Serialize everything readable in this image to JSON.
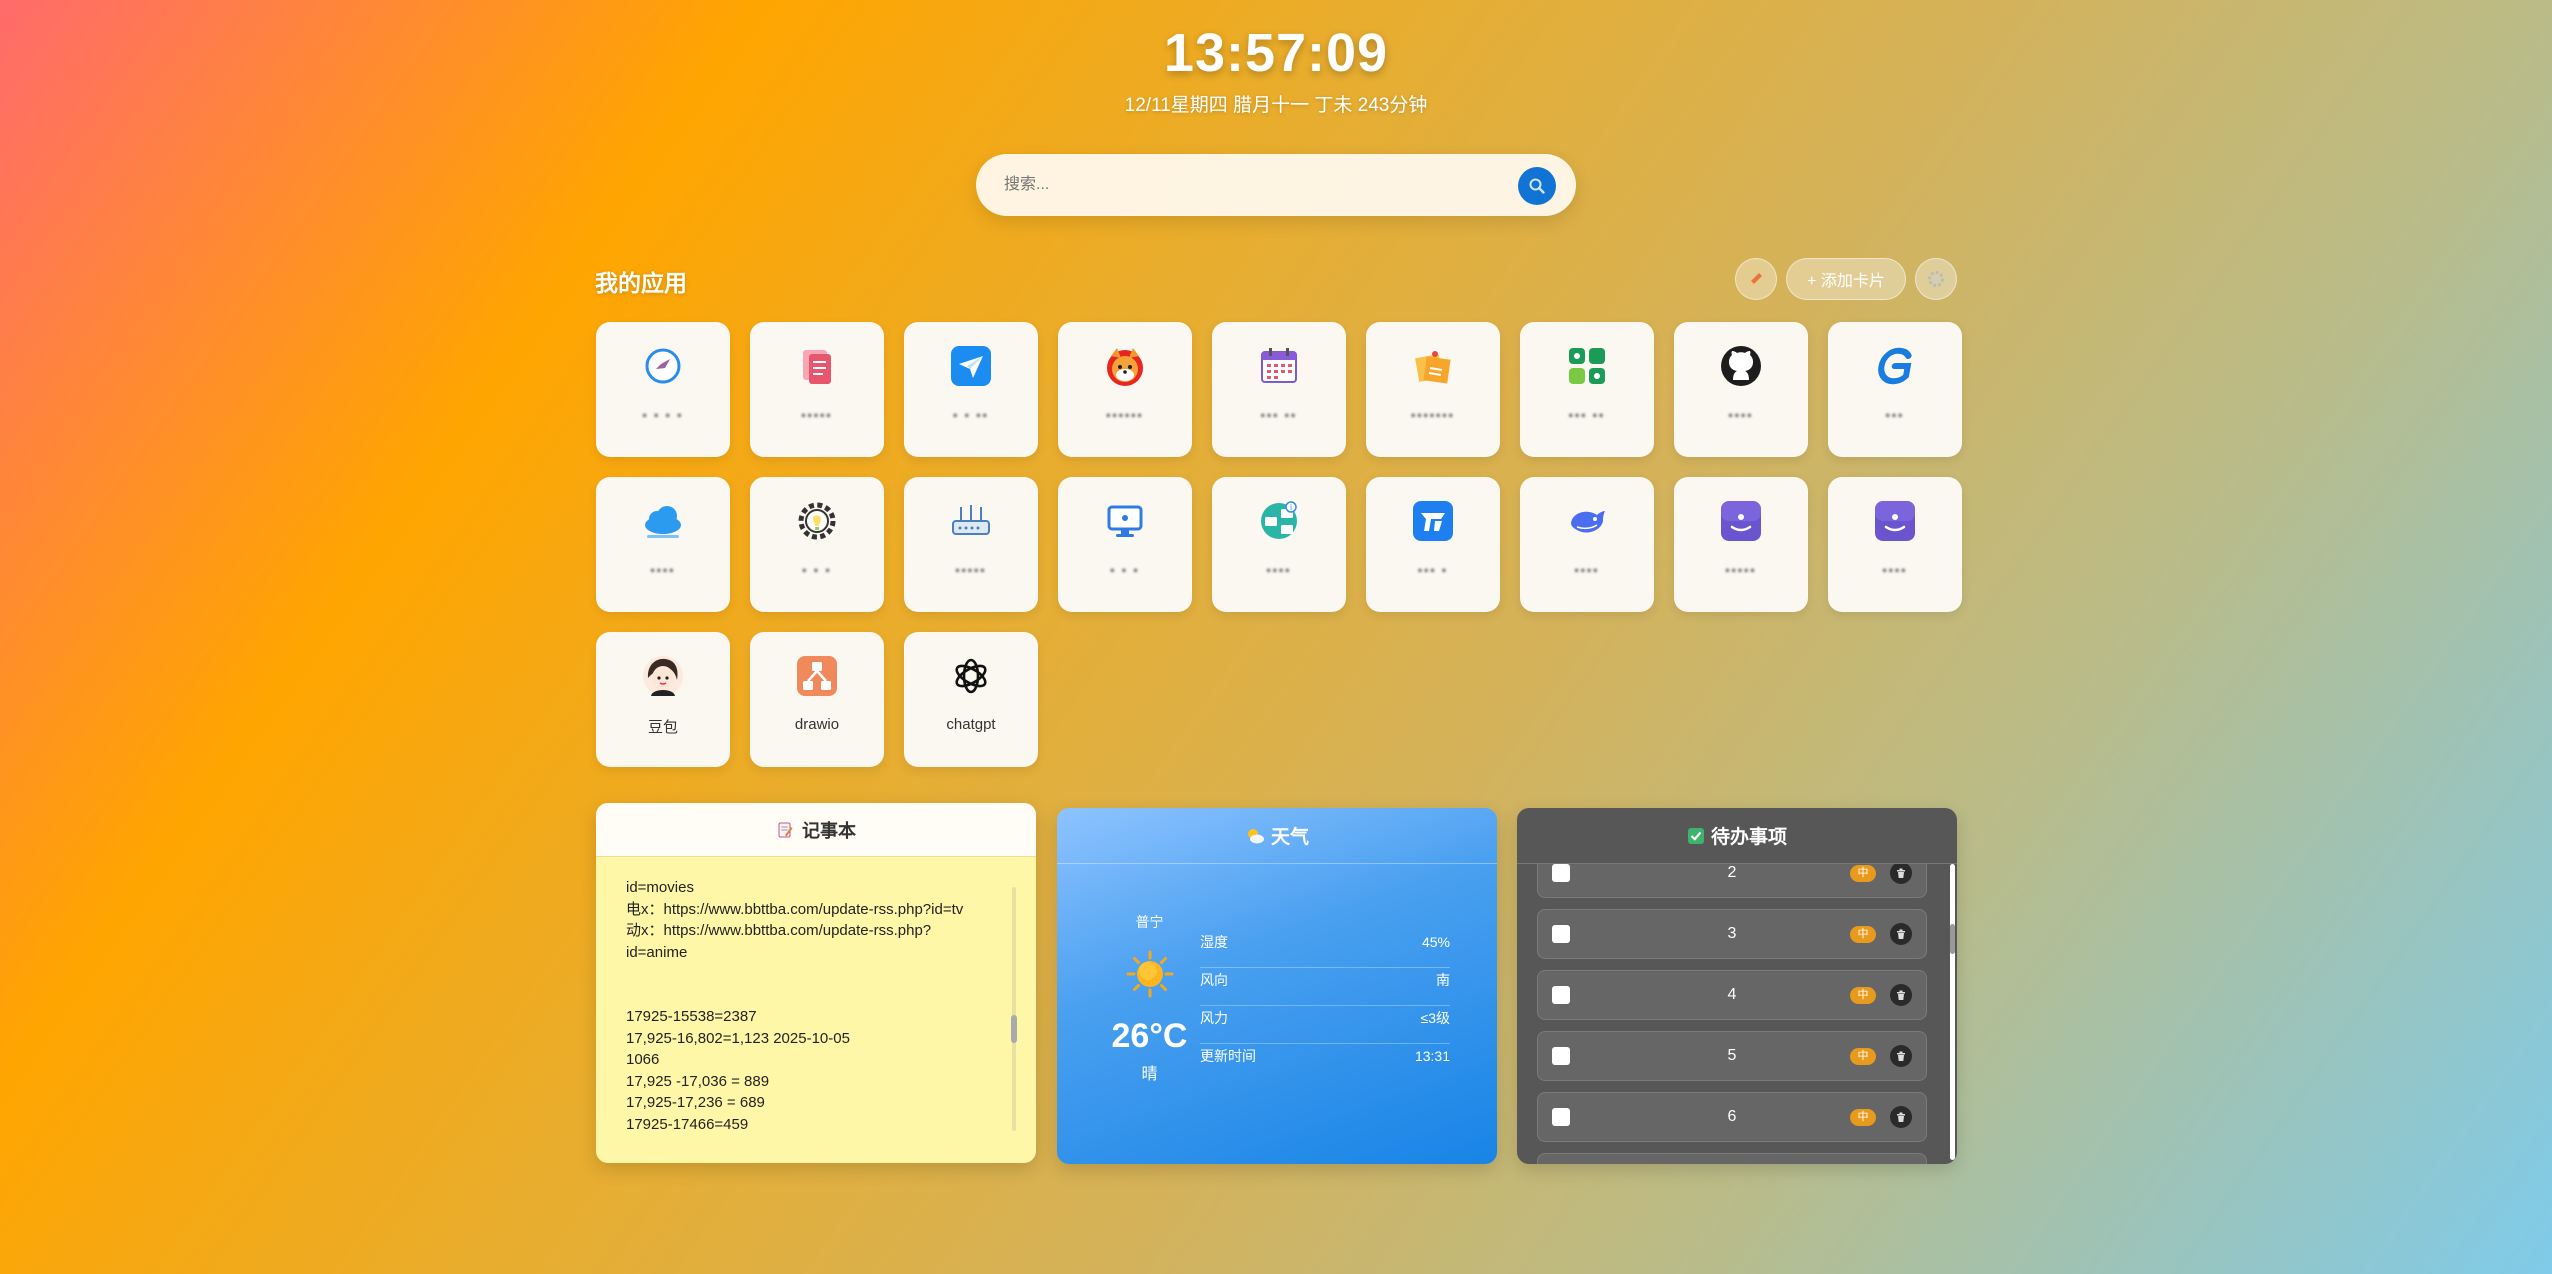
{
  "header": {
    "time": "13:57:09",
    "date": "12/11星期四 腊月十一 丁未 243分钟"
  },
  "search": {
    "placeholder": "搜索..."
  },
  "apps_section": {
    "title": "我的应用",
    "add_label": "+ 添加卡片"
  },
  "apps": [
    {
      "label": "▪ ▪ ▪ ▪",
      "icon": "browser-icon"
    },
    {
      "label": "▪▪▪▪▪",
      "icon": "documents-icon"
    },
    {
      "label": "▪ ▪ ▪▪",
      "icon": "paper-plane-icon"
    },
    {
      "label": "▪▪▪▪▪▪",
      "icon": "shiba-icon"
    },
    {
      "label": "▪▪▪ ▪▪",
      "icon": "calendar-icon"
    },
    {
      "label": "▪▪▪▪▪▪▪",
      "icon": "sticky-notes-icon"
    },
    {
      "label": "▪▪▪ ▪▪",
      "icon": "apps-grid-icon"
    },
    {
      "label": "▪▪▪▪",
      "icon": "github-icon"
    },
    {
      "label": "▪▪▪",
      "icon": "g-logo-icon"
    },
    {
      "label": "▪▪▪▪",
      "icon": "cloud-icon"
    },
    {
      "label": "▪ ▪ ▪",
      "icon": "gear-bulb-icon"
    },
    {
      "label": "▪▪▪▪▪",
      "icon": "router-icon"
    },
    {
      "label": "▪ ▪ ▪",
      "icon": "monitor-icon"
    },
    {
      "label": "▪▪▪▪",
      "icon": "network-info-icon"
    },
    {
      "label": "▪▪▪ ▪",
      "icon": "bird-app-icon"
    },
    {
      "label": "▪▪▪▪",
      "icon": "whale-icon"
    },
    {
      "label": "▪▪▪▪▪",
      "icon": "ai-assistant-icon"
    },
    {
      "label": "▪▪▪▪",
      "icon": "ai-assistant-icon"
    },
    {
      "label": "豆包",
      "icon": "doubao-avatar-icon",
      "clear": true
    },
    {
      "label": "drawio",
      "icon": "drawio-icon",
      "clear": true
    },
    {
      "label": "chatgpt",
      "icon": "chatgpt-icon",
      "clear": true
    }
  ],
  "notepad": {
    "title": "记事本",
    "lines": [
      "id=movies",
      "电x：https://www.bbttba.com/update-rss.php?id=tv",
      "动x：https://www.bbttba.com/update-rss.php?",
      "id=anime",
      "",
      "",
      "17925-15538=2387",
      "17,925-16,802=1,123 2025-10-05",
      "1066",
      "17,925 -17,036 = 889",
      "17,925-17,236 = 689",
      "17925-17466=459"
    ]
  },
  "weather": {
    "title": "天气",
    "city": "普宁",
    "temp": "26°C",
    "condition": "晴",
    "rows": [
      {
        "k": "湿度",
        "v": "45%"
      },
      {
        "k": "风向",
        "v": "南"
      },
      {
        "k": "风力",
        "v": "≤3级"
      },
      {
        "k": "更新时间",
        "v": "13:31"
      }
    ]
  },
  "todo": {
    "title": "待办事项",
    "priority_label": "中",
    "items": [
      "2",
      "3",
      "4",
      "5",
      "6",
      ""
    ]
  },
  "colors": {
    "search_button": "#1173d4",
    "priority_badge": "#e89a1c"
  }
}
